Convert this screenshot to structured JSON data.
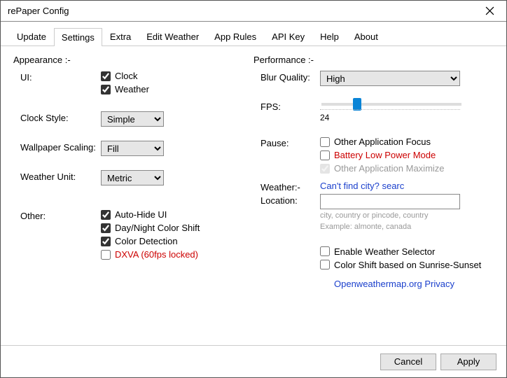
{
  "window": {
    "title": "rePaper Config"
  },
  "tabs": [
    "Update",
    "Settings",
    "Extra",
    "Edit Weather",
    "App Rules",
    "API Key",
    "Help",
    "About"
  ],
  "active_tab": 1,
  "appearance": {
    "header": "Appearance :-",
    "ui_label": "UI:",
    "ui_clock": "Clock",
    "ui_weather": "Weather",
    "clock_style_label": "Clock Style:",
    "clock_style_value": "Simple",
    "wallpaper_scaling_label": "Wallpaper Scaling:",
    "wallpaper_scaling_value": "Fill",
    "weather_unit_label": "Weather Unit:",
    "weather_unit_value": "Metric",
    "other_label": "Other:",
    "other_auto_hide": "Auto-Hide UI",
    "other_daynight": "Day/Night Color Shift",
    "other_color_detect": "Color Detection",
    "other_dxva": "DXVA (60fps locked)"
  },
  "performance": {
    "header": "Performance :-",
    "blur_label": "Blur Quality:",
    "blur_value": "High",
    "fps_label": "FPS:",
    "fps_value": "24",
    "pause_label": "Pause:",
    "pause_focus": "Other Application Focus",
    "pause_battery": "Battery Low Power Mode",
    "pause_maximize": "Other Application Maximize"
  },
  "weather": {
    "header": "Weather:-",
    "loc_label": "Location:",
    "help_link": "Can't find city? searc",
    "loc_value": "",
    "hint_1": "city, country or pincode, country",
    "hint_2": "Example: almonte, canada",
    "enable_selector": "Enable Weather Selector",
    "color_shift_sunrise": "Color Shift based on Sunrise-Sunset",
    "privacy_link": "Openweathermap.org Privacy"
  },
  "footer": {
    "cancel": "Cancel",
    "apply": "Apply"
  }
}
